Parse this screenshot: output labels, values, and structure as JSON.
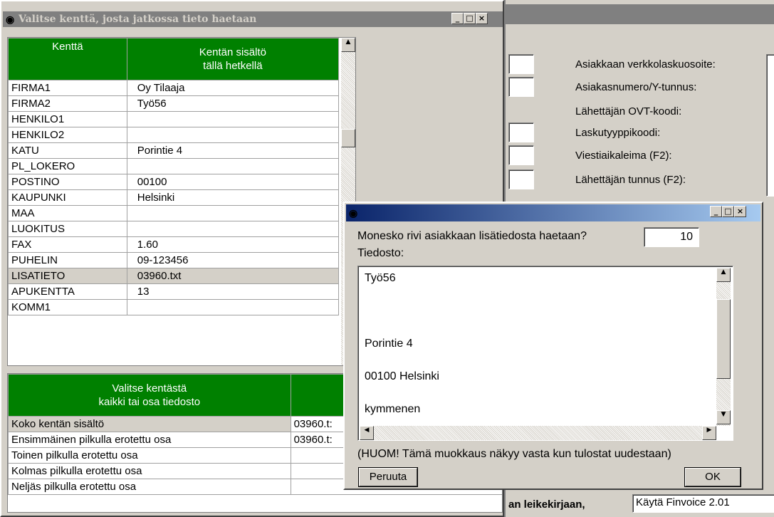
{
  "field_window": {
    "title": "Valitse kenttä, josta jatkossa tieto haetaan",
    "columns": [
      "Kenttä",
      "Kentän sisältö\ntällä hetkellä"
    ],
    "rows": [
      {
        "field": "FIRMA1",
        "value": "Oy Tilaaja"
      },
      {
        "field": "FIRMA2",
        "value": "Työ56"
      },
      {
        "field": "HENKILO1",
        "value": ""
      },
      {
        "field": "HENKILO2",
        "value": ""
      },
      {
        "field": "KATU",
        "value": "Porintie 4"
      },
      {
        "field": "PL_LOKERO",
        "value": ""
      },
      {
        "field": "POSTINO",
        "value": "00100"
      },
      {
        "field": "KAUPUNKI",
        "value": "Helsinki"
      },
      {
        "field": "MAA",
        "value": ""
      },
      {
        "field": "LUOKITUS",
        "value": ""
      },
      {
        "field": "FAX",
        "value": "1.60"
      },
      {
        "field": "PUHELIN",
        "value": "09-123456"
      },
      {
        "field": "LISATIETO",
        "value": "03960.txt"
      },
      {
        "field": "APUKENTTA",
        "value": "13"
      },
      {
        "field": "KOMM1",
        "value": ""
      }
    ],
    "selected_row": 12,
    "part_header": "Valitse kentästä\nkaikki tai osa tiedosto",
    "part_rows": [
      {
        "label": "Koko kentän sisältö",
        "value": "03960.t:"
      },
      {
        "label": "Ensimmäinen pilkulla erotettu osa",
        "value": "03960.t:"
      },
      {
        "label": "Toinen pilkulla erotettu osa",
        "value": ""
      },
      {
        "label": "Kolmas pilkulla erotettu osa",
        "value": ""
      },
      {
        "label": "Neljäs pilkulla erotettu osa",
        "value": ""
      }
    ]
  },
  "background_form": {
    "labels": [
      "Asiakkaan verkkolaskuosoite:",
      "Asiakasnumero/Y-tunnus:",
      "Lähettäjän OVT-koodi:",
      "Laskutyyppikoodi:",
      "Viestiaikaleima (F2):",
      "Lähettäjän tunnus (F2):"
    ],
    "bottom_left": "an leikekirjaan,",
    "bottom_right": "Käytä Finvoice 2.01"
  },
  "dialog": {
    "question": "Monesko rivi asiakkaan lisätiedosta haetaan?",
    "row_value": "10",
    "file_label": "Tiedosto:",
    "file_lines": [
      "Työ56",
      "",
      "Porintie 4",
      "00100 Helsinki",
      "kymmenen"
    ],
    "note": "(HUOM! Tämä muokkaus näkyy vasta kun tulostat uudestaan)",
    "cancel": "Peruuta",
    "ok": "OK"
  }
}
